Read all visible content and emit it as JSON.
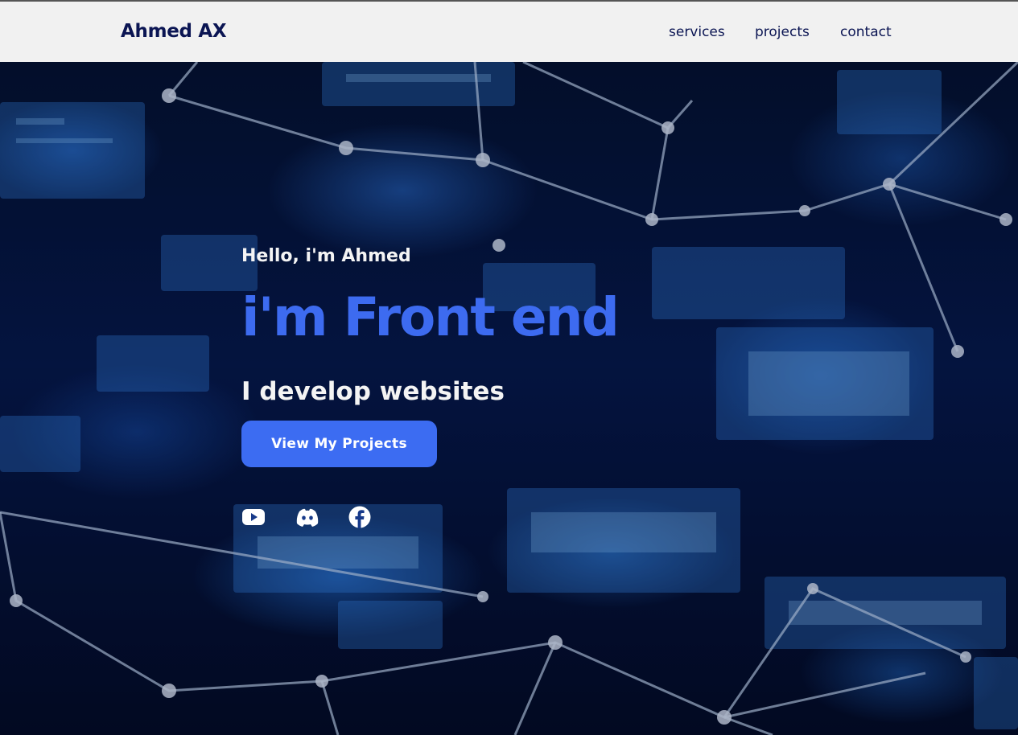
{
  "header": {
    "logo": "Ahmed AX",
    "nav": [
      {
        "label": "services"
      },
      {
        "label": "projects"
      },
      {
        "label": "contact"
      }
    ]
  },
  "hero": {
    "greeting": "Hello, i'm Ahmed",
    "headline": "i'm Front end",
    "subline": "I develop websites",
    "cta_label": "View My Projects",
    "socials": [
      {
        "icon": "youtube-icon"
      },
      {
        "icon": "discord-icon"
      },
      {
        "icon": "facebook-icon"
      }
    ]
  },
  "colors": {
    "header_bg": "#f1f1f1",
    "brand_navy": "#0b1553",
    "accent_blue": "#3c6cf2",
    "hero_text": "#f4f4f4"
  }
}
